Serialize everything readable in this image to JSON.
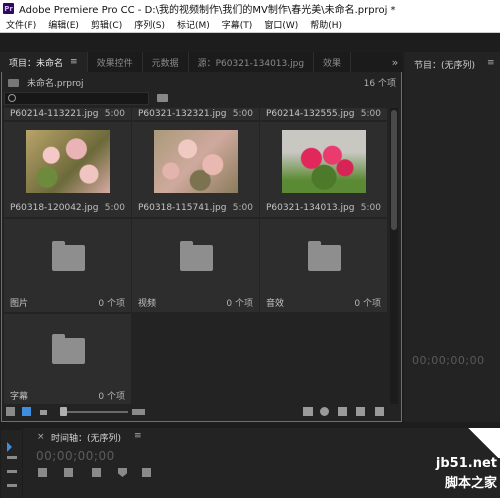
{
  "window": {
    "app_icon": "Pr",
    "title": "Adobe Premiere Pro CC - D:\\我的视频制作\\我们的MV制作\\春光美\\未命名.prproj *"
  },
  "menu": [
    "文件(F)",
    "编辑(E)",
    "剪辑(C)",
    "序列(S)",
    "标记(M)",
    "字幕(T)",
    "窗口(W)",
    "帮助(H)"
  ],
  "tabs": [
    {
      "label": "项目：未命名",
      "active": true
    },
    {
      "label": "效果控件",
      "active": false
    },
    {
      "label": "元数据",
      "active": false
    },
    {
      "label": "源：P60321-134013.jpg",
      "active": false
    },
    {
      "label": "效果",
      "active": false
    }
  ],
  "tab_menu_glyph": "≡",
  "tabs_overflow": "»",
  "project": {
    "file_name": "未命名.prproj",
    "item_count": "16 个项"
  },
  "row_top": [
    {
      "name": "P60214-113221.jpg",
      "duration": "5:00"
    },
    {
      "name": "P60321-132321.jpg",
      "duration": "5:00"
    },
    {
      "name": "P60214-132555.jpg",
      "duration": "5:00"
    }
  ],
  "media": [
    {
      "name": "P60318-120042.jpg",
      "duration": "5:00"
    },
    {
      "name": "P60318-115741.jpg",
      "duration": "5:00"
    },
    {
      "name": "P60321-134013.jpg",
      "duration": "5:00"
    }
  ],
  "folders": [
    {
      "name": "图片",
      "count": "0 个项"
    },
    {
      "name": "视频",
      "count": "0 个项"
    },
    {
      "name": "音效",
      "count": "0 个项"
    },
    {
      "name": "字幕",
      "count": "0 个项"
    }
  ],
  "program": {
    "title": "节目：(无序列)",
    "menu_glyph": "≡",
    "timecode": "00;00;00;00"
  },
  "timeline": {
    "close_glyph": "×",
    "title": "时间轴：(无序列)",
    "menu_glyph": "≡",
    "timecode": "00;00;00;00"
  },
  "watermark": {
    "url": "jb51.net",
    "text": "脚本之家"
  },
  "colors": {
    "panel_focus_border": "#3e7ab8",
    "background": "#1d1d1d",
    "panel": "#232323"
  }
}
